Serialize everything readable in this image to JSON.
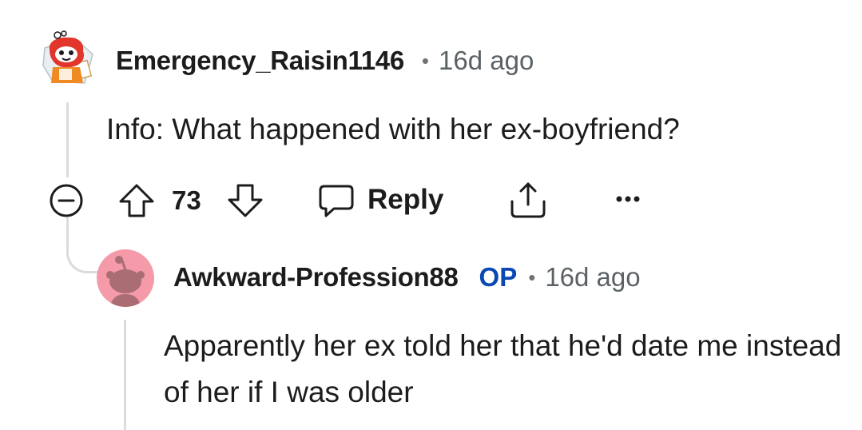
{
  "comment": {
    "username": "Emergency_Raisin1146",
    "time": "16d ago",
    "body": "Info: What happened with her ex-boyfriend?",
    "score": "73",
    "reply_label": "Reply"
  },
  "reply": {
    "username": "Awkward-Profession88",
    "op_badge": "OP",
    "time": "16d ago",
    "body": "Apparently her ex told her that he'd date me instead of her if I was older"
  },
  "icons": {
    "collapse": "collapse-minus-icon",
    "upvote": "upvote-arrow-icon",
    "downvote": "downvote-arrow-icon",
    "reply": "speech-bubble-icon",
    "share": "share-icon",
    "more": "more-dots-icon"
  },
  "colors": {
    "text": "#1c1c1c",
    "meta": "#5b6266",
    "op_badge": "#0a48b3",
    "thread_line": "#d9dcdf",
    "reply_avatar_bg": "#f49aa8"
  }
}
